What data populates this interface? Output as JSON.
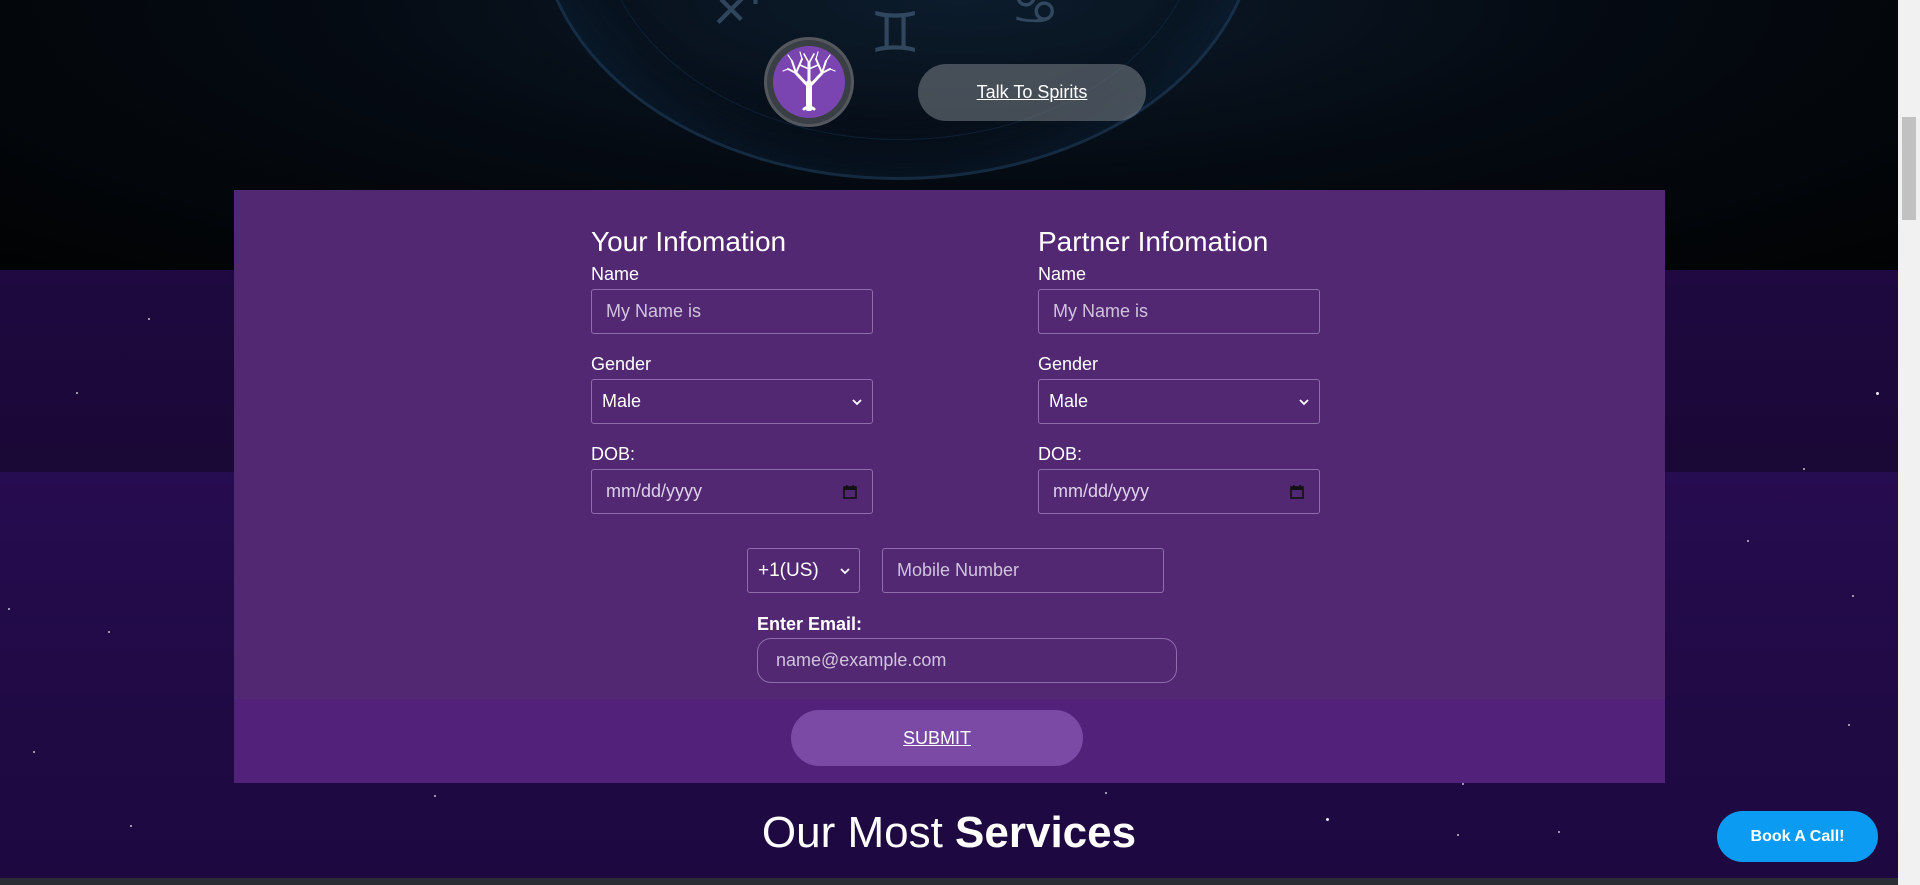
{
  "header": {
    "talk_button": "Talk To Spirits",
    "avatar_icon": "tree-icon"
  },
  "form": {
    "your_info": {
      "heading": "Your Infomation",
      "name_label": "Name",
      "name_placeholder": "My Name is",
      "gender_label": "Gender",
      "gender_value": "Male",
      "dob_label": "DOB:",
      "dob_placeholder": "mm/dd/yyyy"
    },
    "partner_info": {
      "heading": "Partner Infomation",
      "name_label": "Name",
      "name_placeholder": "My Name is",
      "gender_label": "Gender",
      "gender_value": "Male",
      "dob_label": "DOB:",
      "dob_placeholder": "mm/dd/yyyy"
    },
    "country_code": "+1(US)",
    "mobile_placeholder": "Mobile Number",
    "email_label": "Enter Email:",
    "email_placeholder": "name@example.com",
    "submit_label": "SUBMIT"
  },
  "services": {
    "title_regular": "Our Most",
    "title_bold": "Services"
  },
  "book_button": "Book A Call!",
  "colors": {
    "panel": "#522873",
    "book_button": "#0b9bf2",
    "submit": "#7a4aa5"
  }
}
